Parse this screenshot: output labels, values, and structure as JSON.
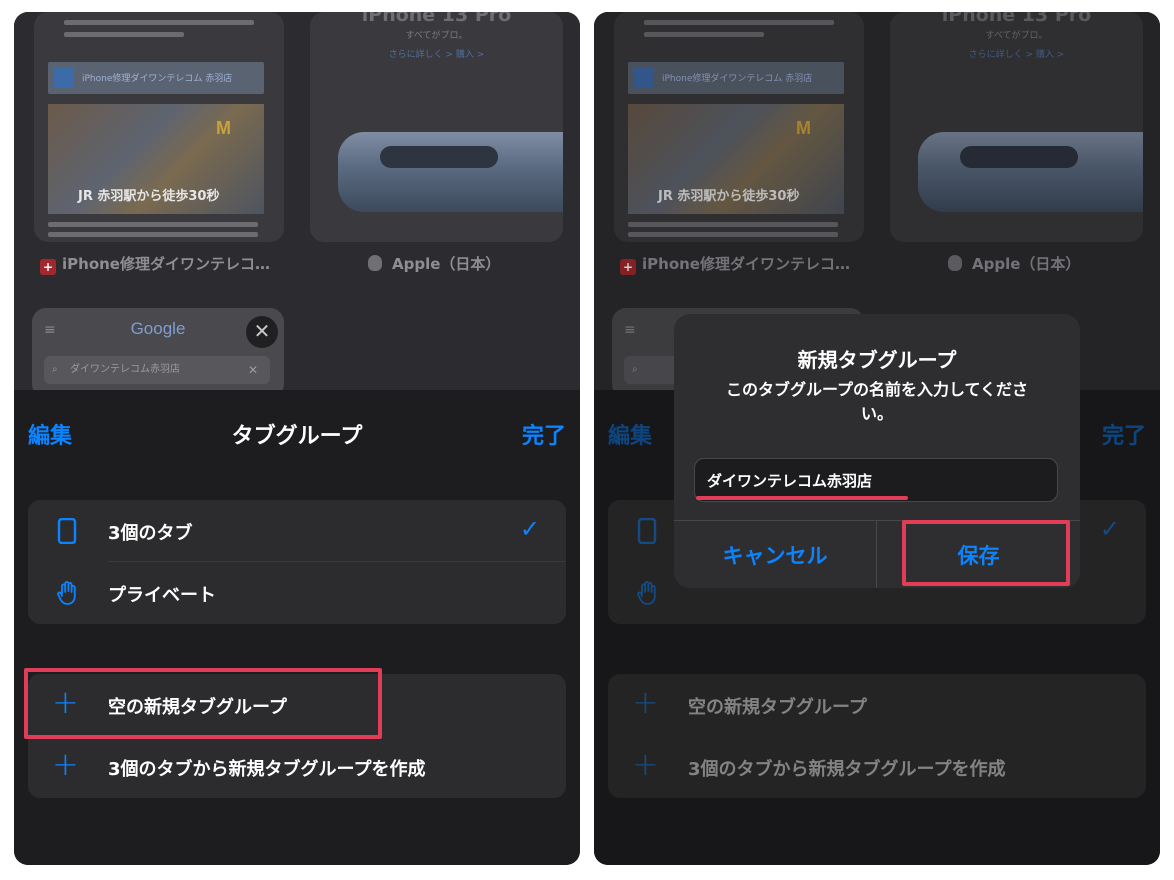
{
  "tab_thumbnails": {
    "left_page": {
      "banner_text": "iPhone修理ダイワンテレコム 赤羽店",
      "photo_caption": "JR 赤羽駅から徒歩30秒",
      "title": "iPhone修理ダイワンテレコ…"
    },
    "right_page": {
      "headline": "iPhone 13 Pro",
      "tagline": "すべてがプロ。",
      "links": "さらに詳しく >   購入 >",
      "title": "Apple（日本）"
    },
    "google_page": {
      "logo": "Google",
      "search_text": "ダイワンテレコム赤羽店"
    }
  },
  "sheet": {
    "edit_label": "編集",
    "title": "タブグループ",
    "done_label": "完了",
    "groups": [
      {
        "label": "3個のタブ",
        "icon": "phone-tabs-icon",
        "checked": true
      },
      {
        "label": "プライベート",
        "icon": "hand-icon",
        "checked": false
      }
    ],
    "new_actions": [
      {
        "label": "空の新規タブグループ"
      },
      {
        "label": "3個のタブから新規タブグループを作成"
      }
    ]
  },
  "dialog": {
    "title": "新規タブグループ",
    "message": "このタブグループの名前を入力してください。",
    "input_value": "ダイワンテレコム赤羽店",
    "cancel_label": "キャンセル",
    "save_label": "保存"
  },
  "colors": {
    "accent": "#0a84ff",
    "highlight": "#e03d56",
    "sheet_bg": "#1d1d20",
    "card_bg": "#2c2c2e"
  }
}
